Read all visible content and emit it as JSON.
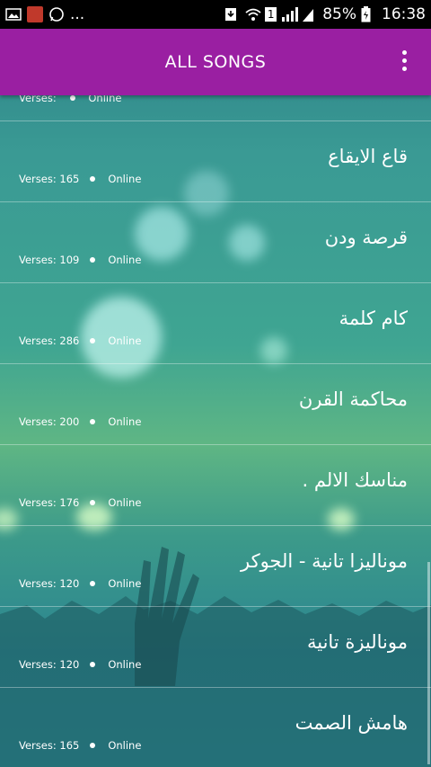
{
  "status_bar": {
    "notifications": [
      "gallery-icon",
      "avatar-icon",
      "whatsapp-icon"
    ],
    "more": "...",
    "battery": "85%",
    "time": "16:38",
    "sim_badge": "1"
  },
  "app_bar": {
    "title": "ALL SONGS"
  },
  "songs": [
    {
      "name": "",
      "verses_label": "Verses:",
      "verses": "",
      "status": "Online"
    },
    {
      "name": "قاع الايقاع",
      "verses_label": "Verses:",
      "verses": "165",
      "status": "Online"
    },
    {
      "name": "قرصة ودن",
      "verses_label": "Verses:",
      "verses": "109",
      "status": "Online"
    },
    {
      "name": "كام كلمة",
      "verses_label": "Verses:",
      "verses": "286",
      "status": "Online"
    },
    {
      "name": "محاكمة القرن",
      "verses_label": "Verses:",
      "verses": "200",
      "status": "Online"
    },
    {
      "name": "مناسك الالم .",
      "verses_label": "Verses:",
      "verses": "176",
      "status": "Online"
    },
    {
      "name": "موناليزا تانية - الجوكر",
      "verses_label": "Verses:",
      "verses": "120",
      "status": "Online"
    },
    {
      "name": "موناليزة تانية",
      "verses_label": "Verses:",
      "verses": "120",
      "status": "Online"
    },
    {
      "name": "هامش الصمت",
      "verses_label": "Verses:",
      "verses": "165",
      "status": "Online"
    }
  ]
}
